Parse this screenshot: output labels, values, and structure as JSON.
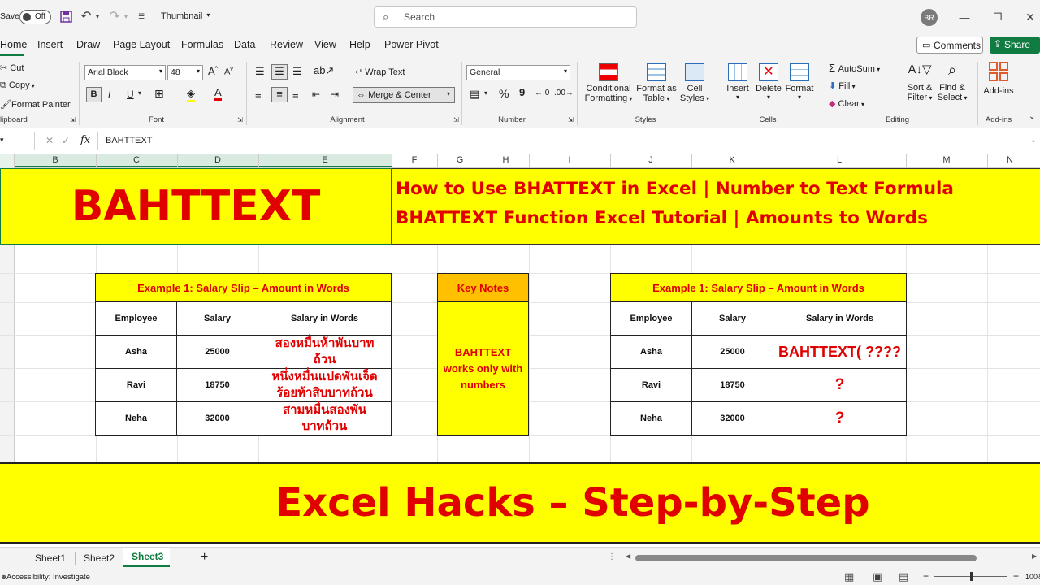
{
  "titlebar": {
    "autosave": "Save",
    "toggle": "Off",
    "doc_name": "Thumbnail",
    "search_placeholder": "Search",
    "avatar": "BR"
  },
  "tabs": [
    "Home",
    "Insert",
    "Draw",
    "Page Layout",
    "Formulas",
    "Data",
    "Review",
    "View",
    "Help",
    "Power Pivot"
  ],
  "tab_actions": {
    "comments": "Comments",
    "share": "Share"
  },
  "ribbon": {
    "clipboard": {
      "cut": "Cut",
      "copy": "Copy",
      "painter": "Format Painter",
      "label": "lipboard"
    },
    "font": {
      "name": "Arial Black",
      "size": "48",
      "bold": "B",
      "italic": "I",
      "underline": "U",
      "label": "Font"
    },
    "alignment": {
      "wrap": "Wrap Text",
      "merge": "Merge & Center",
      "label": "Alignment"
    },
    "number": {
      "format": "General",
      "percent": "%",
      "comma": "9",
      "label": "Number"
    },
    "styles": {
      "cond1": "Conditional",
      "cond2": "Formatting",
      "fmt1": "Format as",
      "fmt2": "Table",
      "cell1": "Cell",
      "cell2": "Styles",
      "label": "Styles"
    },
    "cells": {
      "insert": "Insert",
      "delete": "Delete",
      "format": "Format",
      "label": "Cells"
    },
    "editing": {
      "autosum": "AutoSum",
      "fill": "Fill",
      "clear": "Clear",
      "sort1": "Sort &",
      "sort2": "Filter",
      "find1": "Find &",
      "find2": "Select",
      "label": "Editing"
    },
    "addins": {
      "btn": "Add-ins",
      "label": "Add-ins"
    }
  },
  "formula_bar": {
    "fx": "fx",
    "content": "BAHTTEXT"
  },
  "columns": [
    "B",
    "C",
    "D",
    "E",
    "F",
    "G",
    "H",
    "I",
    "J",
    "K",
    "L",
    "M",
    "N"
  ],
  "sheet": {
    "title": "BAHTTEXT",
    "subtitle1": "How to Use BHATTEXT in Excel | Number to Text Formula",
    "subtitle2": "BHATTEXT Function Excel Tutorial | Amounts to Words",
    "left_table": {
      "header": "Example 1: Salary Slip – Amount in Words",
      "cols": [
        "Employee",
        "Salary",
        "Salary in Words"
      ],
      "rows": [
        {
          "emp": "Asha",
          "salary": "25000",
          "words": "สองหมื่นห้าพันบาท ถ้วน"
        },
        {
          "emp": "Ravi",
          "salary": "18750",
          "words": "หนึ่งหมื่นแปดพันเจ็ด ร้อยห้าสิบบาทถ้วน"
        },
        {
          "emp": "Neha",
          "salary": "32000",
          "words": "สามหมื่นสองพัน บาทถ้วน"
        }
      ]
    },
    "key_notes": {
      "header": "Key Notes",
      "body": "BAHTTEXT works only with numbers"
    },
    "right_table": {
      "header": "Example 1: Salary Slip – Amount in Words",
      "cols": [
        "Employee",
        "Salary",
        "Salary in Words"
      ],
      "rows": [
        {
          "emp": "Asha",
          "salary": "25000",
          "words": "BAHTTEXT( ????"
        },
        {
          "emp": "Ravi",
          "salary": "18750",
          "words": "?"
        },
        {
          "emp": "Neha",
          "salary": "32000",
          "words": "?"
        }
      ]
    },
    "footer": "Excel Hacks – Step-by-Step"
  },
  "sheet_tabs": [
    "Sheet1",
    "Sheet2",
    "Sheet3"
  ],
  "active_sheet": "Sheet3",
  "status": {
    "accessibility": "Accessibility: Investigate",
    "zoom": "100%"
  },
  "colors": {
    "yellow": "#ffff00",
    "orange": "#ffc000",
    "red": "#e00000",
    "green": "#107c41"
  }
}
